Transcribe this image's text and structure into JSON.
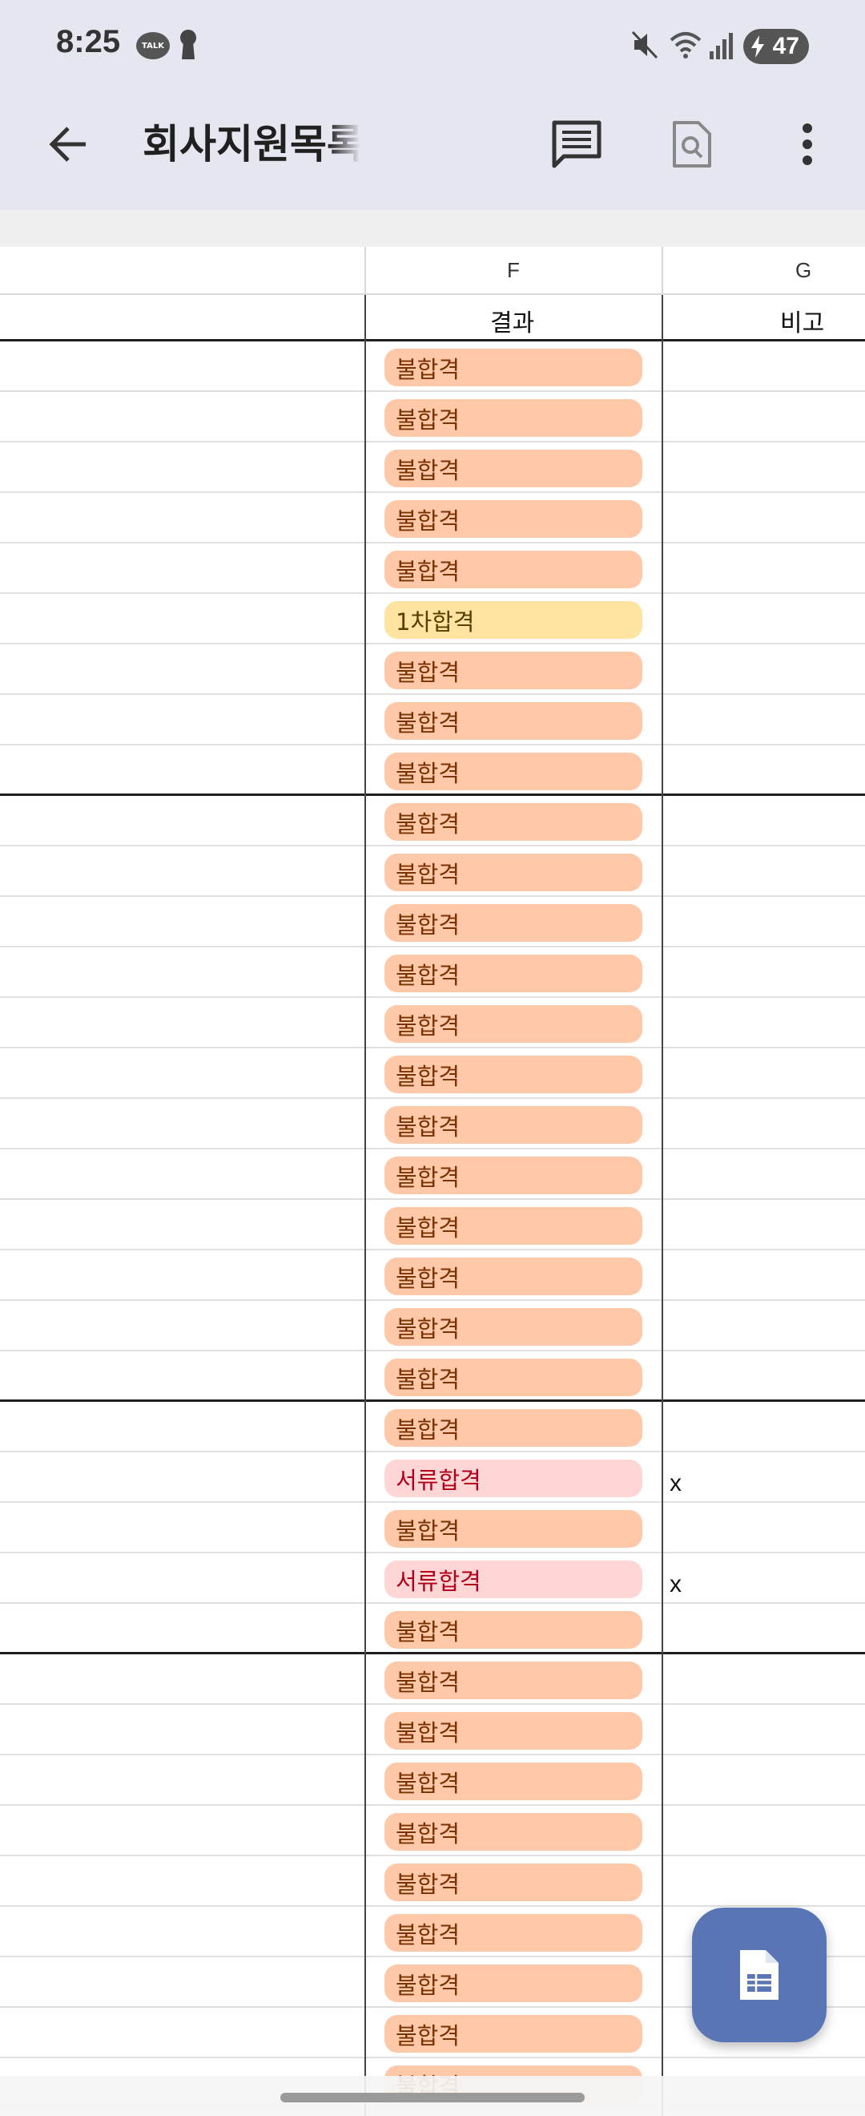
{
  "status_bar": {
    "time": "8:25",
    "talk_badge": "TALK",
    "battery_level": "47"
  },
  "toolbar": {
    "title": "회사지원목록",
    "back_icon": "arrow-left-icon",
    "comment_icon": "comment-icon",
    "find_icon": "document-search-icon",
    "more_icon": "more-vert-icon"
  },
  "sheet": {
    "columns": {
      "f_letter": "F",
      "g_letter": "G"
    },
    "headers": {
      "result": "결과",
      "note": "비고"
    },
    "rows": [
      {
        "result": "불합격",
        "status": "fail",
        "note": ""
      },
      {
        "result": "불합격",
        "status": "fail",
        "note": ""
      },
      {
        "result": "불합격",
        "status": "fail",
        "note": ""
      },
      {
        "result": "불합격",
        "status": "fail",
        "note": ""
      },
      {
        "result": "불합격",
        "status": "fail",
        "note": ""
      },
      {
        "result": "1차합격",
        "status": "first",
        "note": ""
      },
      {
        "result": "불합격",
        "status": "fail",
        "note": ""
      },
      {
        "result": "불합격",
        "status": "fail",
        "note": ""
      },
      {
        "result": "불합격",
        "status": "fail",
        "note": ""
      },
      {
        "result": "불합격",
        "status": "fail",
        "note": ""
      },
      {
        "result": "불합격",
        "status": "fail",
        "note": ""
      },
      {
        "result": "불합격",
        "status": "fail",
        "note": ""
      },
      {
        "result": "불합격",
        "status": "fail",
        "note": ""
      },
      {
        "result": "불합격",
        "status": "fail",
        "note": ""
      },
      {
        "result": "불합격",
        "status": "fail",
        "note": ""
      },
      {
        "result": "불합격",
        "status": "fail",
        "note": ""
      },
      {
        "result": "불합격",
        "status": "fail",
        "note": ""
      },
      {
        "result": "불합격",
        "status": "fail",
        "note": ""
      },
      {
        "result": "불합격",
        "status": "fail",
        "note": ""
      },
      {
        "result": "불합격",
        "status": "fail",
        "note": ""
      },
      {
        "result": "불합격",
        "status": "fail",
        "note": ""
      },
      {
        "result": "불합격",
        "status": "fail",
        "note": ""
      },
      {
        "result": "서류합격",
        "status": "doc",
        "note": "x"
      },
      {
        "result": "불합격",
        "status": "fail",
        "note": ""
      },
      {
        "result": "서류합격",
        "status": "doc",
        "note": "x"
      },
      {
        "result": "불합격",
        "status": "fail",
        "note": ""
      },
      {
        "result": "불합격",
        "status": "fail",
        "note": ""
      },
      {
        "result": "불합격",
        "status": "fail",
        "note": ""
      },
      {
        "result": "불합격",
        "status": "fail",
        "note": ""
      },
      {
        "result": "불합격",
        "status": "fail",
        "note": ""
      },
      {
        "result": "불합격",
        "status": "fail",
        "note": ""
      },
      {
        "result": "불합격",
        "status": "fail",
        "note": ""
      },
      {
        "result": "불합격",
        "status": "fail",
        "note": ""
      },
      {
        "result": "불합격",
        "status": "fail",
        "note": ""
      },
      {
        "result": "불합격",
        "status": "fail",
        "note": ""
      }
    ]
  },
  "fab": {
    "icon": "spreadsheet-icon"
  },
  "colors": {
    "appbar": "#e5e6f0",
    "fail_chip": "#ffc8a8",
    "first_chip": "#ffe3a0",
    "doc_chip": "#ffd6d6",
    "fab": "#5a75b5"
  }
}
